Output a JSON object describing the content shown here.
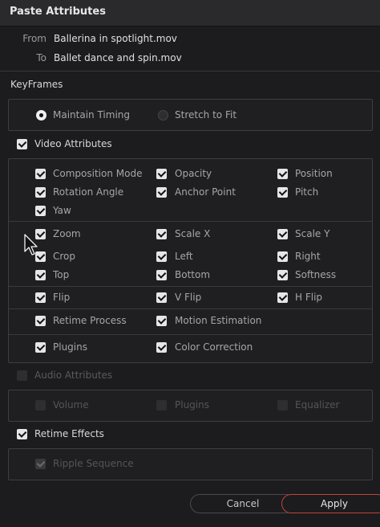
{
  "dialog": {
    "title": "Paste Attributes"
  },
  "source": {
    "from_label": "From",
    "from_value": "Ballerina in spotlight.mov",
    "to_label": "To",
    "to_value": "Ballet dance and spin.mov"
  },
  "keyframes": {
    "label": "KeyFrames",
    "options": [
      {
        "label": "Maintain Timing",
        "selected": true
      },
      {
        "label": "Stretch to Fit",
        "selected": false
      }
    ]
  },
  "video": {
    "label": "Video Attributes",
    "checked": true,
    "items": [
      "Composition Mode",
      "Opacity",
      "Position",
      "Rotation Angle",
      "Anchor Point",
      "Pitch",
      "Yaw",
      "Zoom",
      "Scale X",
      "Scale Y",
      "Crop",
      "Left",
      "Right",
      "Top",
      "Bottom",
      "Softness",
      "Flip",
      "V Flip",
      "H Flip",
      "Retime Process",
      "Motion Estimation",
      "Plugins",
      "Color Correction"
    ]
  },
  "audio": {
    "label": "Audio Attributes",
    "checked": false,
    "enabled": false,
    "items": [
      "Volume",
      "Plugins",
      "Equalizer"
    ]
  },
  "retime": {
    "label": "Retime Effects",
    "checked": true,
    "items": [
      "Ripple Sequence"
    ]
  },
  "buttons": {
    "cancel": "Cancel",
    "apply": "Apply"
  },
  "colors": {
    "accent_border": "#c0443a",
    "background": "#1c1c1e",
    "checkbox": "#e6e6e6"
  }
}
